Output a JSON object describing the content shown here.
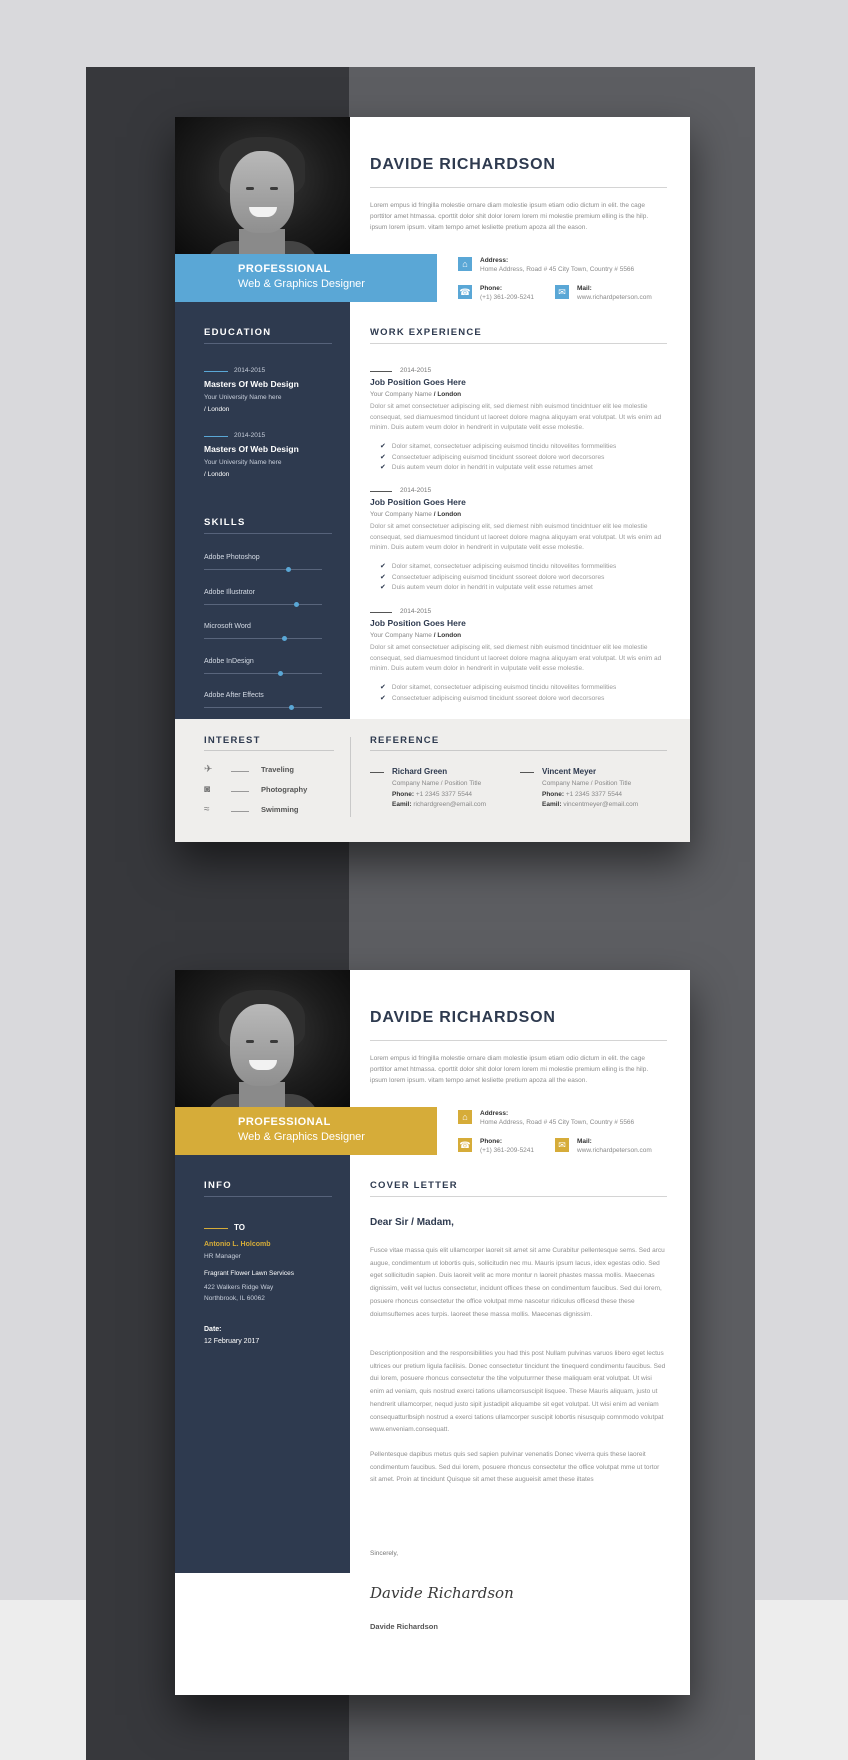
{
  "page1": {
    "name": "DAVIDE RICHARDSON",
    "intro": "Lorem empus id fringilla molestie ornare diam molestie ipsum etiam odio dictum in elit. the cage porttitor amet htmassa. cporttit dolor shit dolor lorem lorem mi molestie premium elling is the hilp. ipsum lorem ipsum. vitam tempo amet lesliette pretium apoza all the eason.",
    "profession_title": "PROFESSIONAL",
    "profession_role": "Web & Graphics Designer",
    "address_label": "Address:",
    "address_value": "Home Address, Road # 45 City Town, Country # 5566",
    "phone_label": "Phone:",
    "phone_value": "(+1) 361-209-5241",
    "mail_label": "Mail:",
    "mail_value": "www.richardpeterson.com",
    "education_heading": "EDUCATION",
    "education": [
      {
        "year": "2014-2015",
        "degree": "Masters Of Web Design",
        "uni": "Your University Name here",
        "loc": "/ London"
      },
      {
        "year": "2014-2015",
        "degree": "Masters Of Web Design",
        "uni": "Your University Name here",
        "loc": "/ London"
      }
    ],
    "skills_heading": "SKILLS",
    "skills": [
      {
        "name": "Adobe Photoshop",
        "level": 0.72
      },
      {
        "name": "Adobe Illustrator",
        "level": 0.78
      },
      {
        "name": "Microsoft Word",
        "level": 0.68
      },
      {
        "name": "Adobe InDesign",
        "level": 0.65
      },
      {
        "name": "Adobe After Effects",
        "level": 0.74
      }
    ],
    "work_heading": "WORK EXPERIENCE",
    "jobs": [
      {
        "year": "2014-2015",
        "position": "Job Position Goes Here",
        "company": "Your Company Name",
        "city": "/ London",
        "desc": "Dolor sit amet consectetuer adipiscing elit, sed diemest nibh euismod tincidntuer elit lee molestie consequat, sed diamuesmod tincidunt ut laoreet dolore magna aliquyam erat volutpat. Ut wis enim ad minim. Duis autem veum dolor in hendrerit in vulputate velit esse molestie.",
        "bullets": [
          "Dolor sitamet, consectetuer adipiscing euismod tincidu nitovelites formmelities",
          "Consectetuer adipiscing euismod tincidunt ssoreet dolore worl decorsores",
          "Duis autem veum dolor in hendrit in vulputate velit esse retumes amet"
        ]
      },
      {
        "year": "2014-2015",
        "position": "Job Position Goes Here",
        "company": "Your Company Name",
        "city": "/ London",
        "desc": "Dolor sit amet consectetuer adipiscing elit, sed diemest nibh euismod tincidntuer elit lee molestie consequat, sed diamuesmod tincidunt ut laoreet dolore magna aliquyam erat volutpat. Ut wis enim ad minim. Duis autem veum dolor in hendrerit in vulputate velit esse molestie.",
        "bullets": [
          "Dolor sitamet, consectetuer adipiscing euismod tincidu nitovelites formmelities",
          "Consectetuer adipiscing euismod tincidunt ssoreet dolore worl decorsores",
          "Duis autem veum dolor in hendrit in vulputate velit esse retumes amet"
        ]
      },
      {
        "year": "2014-2015",
        "position": "Job Position Goes Here",
        "company": "Your Company Name",
        "city": "/ London",
        "desc": "Dolor sit amet consectetuer adipiscing elit, sed diemest nibh euismod tincidntuer elit lee molestie consequat, sed diamuesmod tincidunt ut laoreet dolore magna aliquyam erat volutpat. Ut wis enim ad minim. Duis autem veum dolor in hendrerit in vulputate velit esse molestie.",
        "bullets": [
          "Dolor sitamet, consectetuer adipiscing euismod tincidu nitovelites formmelities",
          "Consectetuer adipiscing euismod tincidunt ssoreet dolore worl decorsores"
        ]
      }
    ],
    "interest_heading": "INTEREST",
    "interests": [
      {
        "icon": "airplane-icon",
        "label": "Traveling"
      },
      {
        "icon": "camera-icon",
        "label": "Photography"
      },
      {
        "icon": "swimming-icon",
        "label": "Swimming"
      }
    ],
    "reference_heading": "REFERENCE",
    "references": [
      {
        "name": "Richard Green",
        "company": "Company Name / Position Title",
        "phone_label": "Phone:",
        "phone": "+1 2345 3377 5544",
        "email_label": "Eamil:",
        "email": "richardgreen@email.com"
      },
      {
        "name": "Vincent Meyer",
        "company": "Company Name / Position Title",
        "phone_label": "Phone:",
        "phone": "+1 2345 3377 5544",
        "email_label": "Eamil:",
        "email": "vincentmeyer@email.com"
      }
    ]
  },
  "page2": {
    "name": "DAVIDE RICHARDSON",
    "intro": "Lorem empus id fringilla molestie ornare diam molestie ipsum etiam odio dictum in elit. the cage porttitor amet htmassa. cporttit dolor shit dolor lorem lorem mi molestie premium elling is the hilp. ipsum lorem ipsum. vitam tempo amet lesliette pretium apoza all the eason.",
    "profession_title": "PROFESSIONAL",
    "profession_role": "Web & Graphics Designer",
    "address_label": "Address:",
    "address_value": "Home Address, Road # 45 City Town, Country # 5566",
    "phone_label": "Phone:",
    "phone_value": "(+1) 361-209-5241",
    "mail_label": "Mail:",
    "mail_value": "www.richardpeterson.com",
    "info_heading": "INFO",
    "to_label": "TO",
    "recipient": "Antonio L. Holcomb",
    "recipient_role": "HR Manager",
    "company": "Fragrant Flower Lawn Services",
    "street": "422 Walkers Ridge Way",
    "city": "Northbrook, IL 60062",
    "date_label": "Date:",
    "date": "12 February 2017",
    "cover_heading": "COVER LETTER",
    "greeting": "Dear Sir / Madam,",
    "paragraphs": [
      "Fusce vitae massa quis elit ullamcorper laoreit sit amet sit ame Curabitur pellentesque sems. Sed arcu augue, condimentum ut lobortis quis, sollicitudin nec mu. Mauris ipsum lacus, idex egestas odio. Sed eget sollicitudin sapien. Duis laoreit velit ac more montur n laoreit phastes massa mollis. Maecenas dignissim, velit vel luctus consectetur, incidunt offices these on condimentum faucibus. Sed dui lorem, posuere rhoncus consectetur the office volutpat mme nascetur ridiculus officesd these these doiumsuftemes aces turpis. laoreet these massa mollis. Maecenas dignissim.",
      "Descriptionposition and the responsibilities you had this post Nullam pulvinas varuos libero eget lectus ultrices our pretium ligula facilisis. Donec consectetur tincidunt the tinequerd condimentu faucibus. Sed dui lorem, posuere rhoncus consectetur the tihe volputurrner these maliquam erat volutpat. Ut wisi enim ad veniam, quis nostrud exerci tations ullamcorsuscipit lisquee. These Mauris aliquam, justo ut hendrerit ullamcorper, nequd justo sipit justadipit aliquambe sit eget volutpat. Ut wisi enim ad veniam consequatturlbsiph nostrud a exerci tations ullamcorper suscipit lobortis nisusquip comnmodo volutpat www.enveniam.consequatt.",
      "Pellentesque dapibus metus quis sed sapien pulvinar venenatis Donec viverra quis these laoreit condimentum faucibus. Sed dui lorem, posuere rhoncus consectetur the office volutpat mme ut tortor sit amet. Proin at tincidunt Quisque sit amet these augueisit amet these iltates"
    ],
    "sincerely": "Sincerely,",
    "signature": "Davide Richardson",
    "signer": "Davide Richardson"
  },
  "colors": {
    "navy": "#2e3a4f",
    "blue_accent": "#5aa7d6",
    "gold_accent": "#d6ac39"
  }
}
